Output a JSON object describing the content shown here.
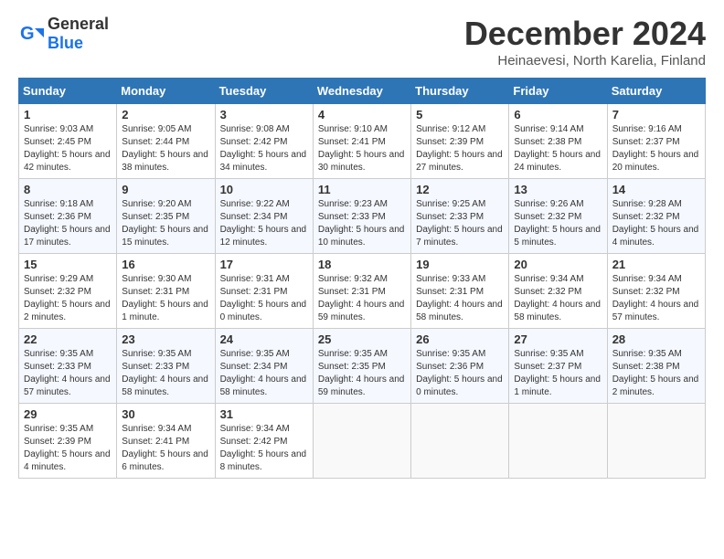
{
  "logo": {
    "general": "General",
    "blue": "Blue"
  },
  "header": {
    "month": "December 2024",
    "location": "Heinaevesi, North Karelia, Finland"
  },
  "weekdays": [
    "Sunday",
    "Monday",
    "Tuesday",
    "Wednesday",
    "Thursday",
    "Friday",
    "Saturday"
  ],
  "weeks": [
    [
      {
        "day": "1",
        "sunrise": "9:03 AM",
        "sunset": "2:45 PM",
        "daylight": "5 hours and 42 minutes."
      },
      {
        "day": "2",
        "sunrise": "9:05 AM",
        "sunset": "2:44 PM",
        "daylight": "5 hours and 38 minutes."
      },
      {
        "day": "3",
        "sunrise": "9:08 AM",
        "sunset": "2:42 PM",
        "daylight": "5 hours and 34 minutes."
      },
      {
        "day": "4",
        "sunrise": "9:10 AM",
        "sunset": "2:41 PM",
        "daylight": "5 hours and 30 minutes."
      },
      {
        "day": "5",
        "sunrise": "9:12 AM",
        "sunset": "2:39 PM",
        "daylight": "5 hours and 27 minutes."
      },
      {
        "day": "6",
        "sunrise": "9:14 AM",
        "sunset": "2:38 PM",
        "daylight": "5 hours and 24 minutes."
      },
      {
        "day": "7",
        "sunrise": "9:16 AM",
        "sunset": "2:37 PM",
        "daylight": "5 hours and 20 minutes."
      }
    ],
    [
      {
        "day": "8",
        "sunrise": "9:18 AM",
        "sunset": "2:36 PM",
        "daylight": "5 hours and 17 minutes."
      },
      {
        "day": "9",
        "sunrise": "9:20 AM",
        "sunset": "2:35 PM",
        "daylight": "5 hours and 15 minutes."
      },
      {
        "day": "10",
        "sunrise": "9:22 AM",
        "sunset": "2:34 PM",
        "daylight": "5 hours and 12 minutes."
      },
      {
        "day": "11",
        "sunrise": "9:23 AM",
        "sunset": "2:33 PM",
        "daylight": "5 hours and 10 minutes."
      },
      {
        "day": "12",
        "sunrise": "9:25 AM",
        "sunset": "2:33 PM",
        "daylight": "5 hours and 7 minutes."
      },
      {
        "day": "13",
        "sunrise": "9:26 AM",
        "sunset": "2:32 PM",
        "daylight": "5 hours and 5 minutes."
      },
      {
        "day": "14",
        "sunrise": "9:28 AM",
        "sunset": "2:32 PM",
        "daylight": "5 hours and 4 minutes."
      }
    ],
    [
      {
        "day": "15",
        "sunrise": "9:29 AM",
        "sunset": "2:32 PM",
        "daylight": "5 hours and 2 minutes."
      },
      {
        "day": "16",
        "sunrise": "9:30 AM",
        "sunset": "2:31 PM",
        "daylight": "5 hours and 1 minute."
      },
      {
        "day": "17",
        "sunrise": "9:31 AM",
        "sunset": "2:31 PM",
        "daylight": "5 hours and 0 minutes."
      },
      {
        "day": "18",
        "sunrise": "9:32 AM",
        "sunset": "2:31 PM",
        "daylight": "4 hours and 59 minutes."
      },
      {
        "day": "19",
        "sunrise": "9:33 AM",
        "sunset": "2:31 PM",
        "daylight": "4 hours and 58 minutes."
      },
      {
        "day": "20",
        "sunrise": "9:34 AM",
        "sunset": "2:32 PM",
        "daylight": "4 hours and 58 minutes."
      },
      {
        "day": "21",
        "sunrise": "9:34 AM",
        "sunset": "2:32 PM",
        "daylight": "4 hours and 57 minutes."
      }
    ],
    [
      {
        "day": "22",
        "sunrise": "9:35 AM",
        "sunset": "2:33 PM",
        "daylight": "4 hours and 57 minutes."
      },
      {
        "day": "23",
        "sunrise": "9:35 AM",
        "sunset": "2:33 PM",
        "daylight": "4 hours and 58 minutes."
      },
      {
        "day": "24",
        "sunrise": "9:35 AM",
        "sunset": "2:34 PM",
        "daylight": "4 hours and 58 minutes."
      },
      {
        "day": "25",
        "sunrise": "9:35 AM",
        "sunset": "2:35 PM",
        "daylight": "4 hours and 59 minutes."
      },
      {
        "day": "26",
        "sunrise": "9:35 AM",
        "sunset": "2:36 PM",
        "daylight": "5 hours and 0 minutes."
      },
      {
        "day": "27",
        "sunrise": "9:35 AM",
        "sunset": "2:37 PM",
        "daylight": "5 hours and 1 minute."
      },
      {
        "day": "28",
        "sunrise": "9:35 AM",
        "sunset": "2:38 PM",
        "daylight": "5 hours and 2 minutes."
      }
    ],
    [
      {
        "day": "29",
        "sunrise": "9:35 AM",
        "sunset": "2:39 PM",
        "daylight": "5 hours and 4 minutes."
      },
      {
        "day": "30",
        "sunrise": "9:34 AM",
        "sunset": "2:41 PM",
        "daylight": "5 hours and 6 minutes."
      },
      {
        "day": "31",
        "sunrise": "9:34 AM",
        "sunset": "2:42 PM",
        "daylight": "5 hours and 8 minutes."
      },
      null,
      null,
      null,
      null
    ]
  ]
}
